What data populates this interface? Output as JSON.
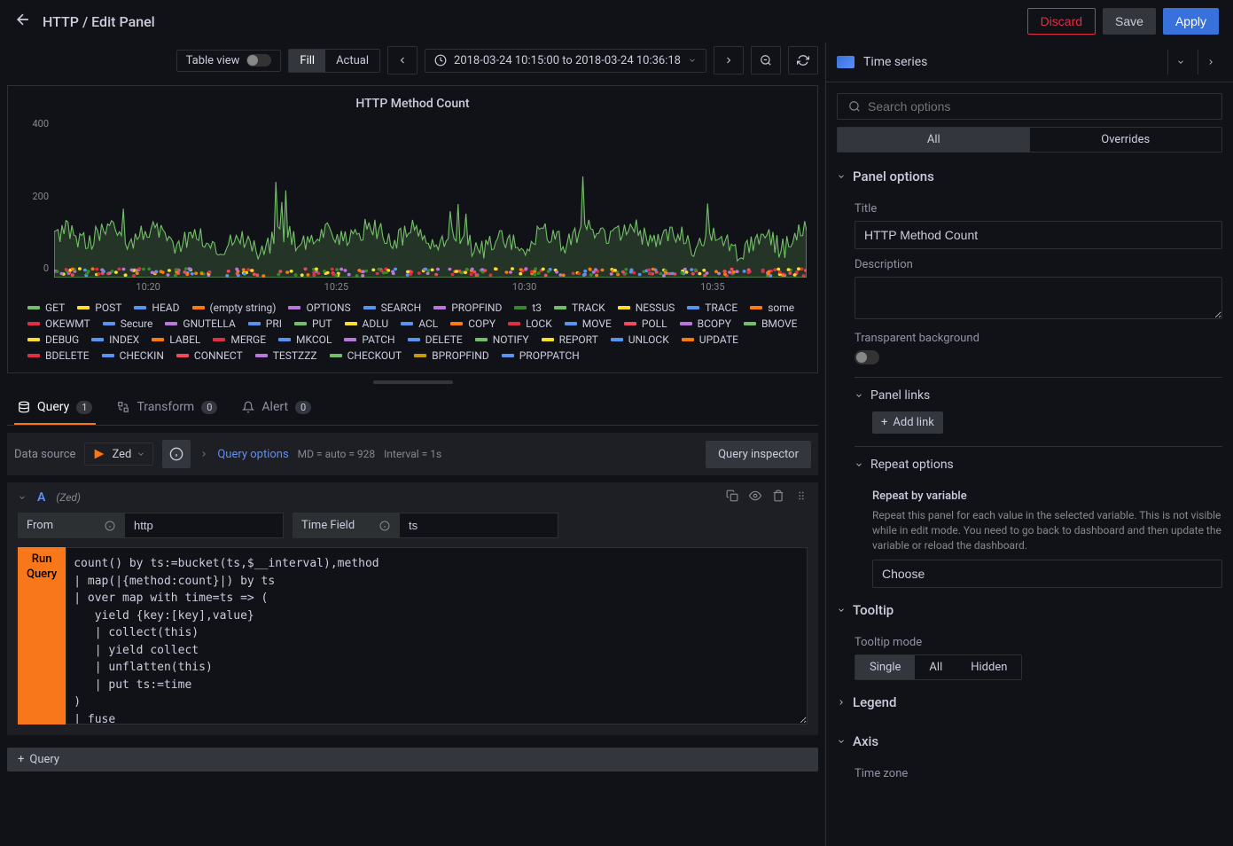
{
  "header": {
    "breadcrumb": "HTTP / Edit Panel",
    "discard": "Discard",
    "save": "Save",
    "apply": "Apply"
  },
  "toolbar": {
    "table_view": "Table view",
    "fill": "Fill",
    "actual": "Actual",
    "time_range": "2018-03-24 10:15:00 to 2018-03-24 10:36:18"
  },
  "viz": {
    "name": "Time series"
  },
  "chart_data": {
    "type": "line",
    "title": "HTTP Method Count",
    "ylabel": "",
    "xlabel": "",
    "ylim": [
      0,
      450
    ],
    "yticks": [
      0,
      200,
      400
    ],
    "xticks": [
      "10:20",
      "10:25",
      "10:30",
      "10:35"
    ],
    "series": [
      {
        "name": "GET",
        "color": "#73bf69"
      },
      {
        "name": "POST",
        "color": "#fade2a"
      },
      {
        "name": "HEAD",
        "color": "#5794f2"
      },
      {
        "name": "(empty string)",
        "color": "#ff780a"
      },
      {
        "name": "OPTIONS",
        "color": "#b877d9"
      },
      {
        "name": "SEARCH",
        "color": "#5794f2"
      },
      {
        "name": "PROPFIND",
        "color": "#b877d9"
      },
      {
        "name": "t3",
        "color": "#37872d"
      },
      {
        "name": "TRACK",
        "color": "#73bf69"
      },
      {
        "name": "NESSUS",
        "color": "#fade2a"
      },
      {
        "name": "TRACE",
        "color": "#5794f2"
      },
      {
        "name": "some",
        "color": "#ff780a"
      },
      {
        "name": "OKEWMT",
        "color": "#e02f44"
      },
      {
        "name": "Secure",
        "color": "#5794f2"
      },
      {
        "name": "GNUTELLA",
        "color": "#b877d9"
      },
      {
        "name": "PRI",
        "color": "#5794f2"
      },
      {
        "name": "PUT",
        "color": "#73bf69"
      },
      {
        "name": "ADLU",
        "color": "#fade2a"
      },
      {
        "name": "ACL",
        "color": "#5794f2"
      },
      {
        "name": "COPY",
        "color": "#ff780a"
      },
      {
        "name": "LOCK",
        "color": "#e02f44"
      },
      {
        "name": "MOVE",
        "color": "#5794f2"
      },
      {
        "name": "POLL",
        "color": "#f2495c"
      },
      {
        "name": "BCOPY",
        "color": "#b877d9"
      },
      {
        "name": "BMOVE",
        "color": "#73bf69"
      },
      {
        "name": "DEBUG",
        "color": "#fade2a"
      },
      {
        "name": "INDEX",
        "color": "#5794f2"
      },
      {
        "name": "LABEL",
        "color": "#ff780a"
      },
      {
        "name": "MERGE",
        "color": "#e02f44"
      },
      {
        "name": "MKCOL",
        "color": "#5794f2"
      },
      {
        "name": "PATCH",
        "color": "#b877d9"
      },
      {
        "name": "DELETE",
        "color": "#5794f2"
      },
      {
        "name": "NOTIFY",
        "color": "#73bf69"
      },
      {
        "name": "REPORT",
        "color": "#fade2a"
      },
      {
        "name": "UNLOCK",
        "color": "#5794f2"
      },
      {
        "name": "UPDATE",
        "color": "#ff780a"
      },
      {
        "name": "BDELETE",
        "color": "#e02f44"
      },
      {
        "name": "CHECKIN",
        "color": "#5794f2"
      },
      {
        "name": "CONNECT",
        "color": "#f2495c"
      },
      {
        "name": "TESTZZZ",
        "color": "#b877d9"
      },
      {
        "name": "CHECKOUT",
        "color": "#73bf69"
      },
      {
        "name": "BPROPFIND",
        "color": "#c69b06"
      },
      {
        "name": "PROPPATCH",
        "color": "#5794f2"
      }
    ]
  },
  "tabs": {
    "query": "Query",
    "query_count": "1",
    "transform": "Transform",
    "transform_count": "0",
    "alert": "Alert",
    "alert_count": "0"
  },
  "query_toolbar": {
    "data_source_label": "Data source",
    "data_source": "Zed",
    "query_options": "Query options",
    "md": "MD = auto = 928",
    "interval": "Interval = 1s",
    "inspector": "Query inspector"
  },
  "query_row": {
    "letter": "A",
    "ds": "(Zed)",
    "from_label": "From",
    "from_value": "http",
    "time_field_label": "Time Field",
    "time_field_value": "ts",
    "run_query": "Run Query",
    "query_text": "count() by ts:=bucket(ts,$__interval),method\n| map(|{method:count}|) by ts\n| over map with time=ts => (\n   yield {key:[key],value}\n   | collect(this)\n   | yield collect\n   | unflatten(this)\n   | put ts:=time\n)\n| fuse"
  },
  "add_query": "Query",
  "options": {
    "search_placeholder": "Search options",
    "tab_all": "All",
    "tab_overrides": "Overrides",
    "panel_options": "Panel options",
    "title_label": "Title",
    "title_value": "HTTP Method Count",
    "description_label": "Description",
    "transparent_label": "Transparent background",
    "panel_links": "Panel links",
    "add_link": "Add link",
    "repeat_options": "Repeat options",
    "repeat_by_var": "Repeat by variable",
    "repeat_help": "Repeat this panel for each value in the selected variable. This is not visible while in edit mode. You need to go back to dashboard and then update the variable or reload the dashboard.",
    "choose": "Choose",
    "tooltip": "Tooltip",
    "tooltip_mode": "Tooltip mode",
    "tooltip_single": "Single",
    "tooltip_all": "All",
    "tooltip_hidden": "Hidden",
    "legend": "Legend",
    "axis": "Axis",
    "time_zone": "Time zone"
  }
}
